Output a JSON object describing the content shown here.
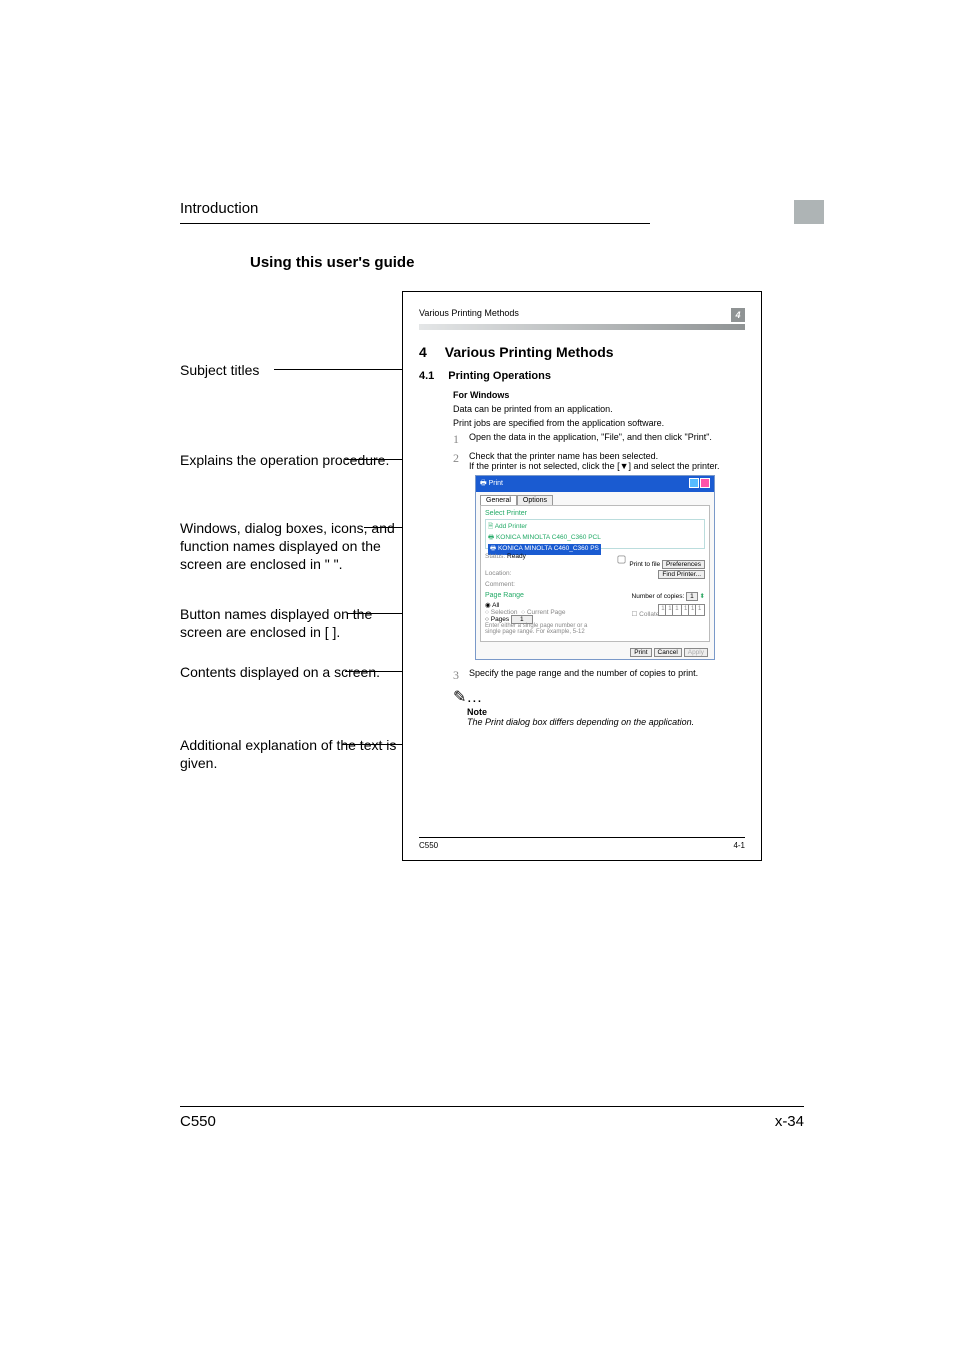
{
  "breadcrumb": "Introduction",
  "section_title": "Using this user's guide",
  "labels": {
    "l1": "Subject titles",
    "l2": "Explains the operation procedure.",
    "l3": "Windows, dialog boxes, icons, and function names displayed on the screen are enclosed in \" \".",
    "l4": "Button names displayed on the screen are enclosed in [  ].",
    "l5": "Contents displayed on a screen.",
    "l6": "Additional explanation of the text is given."
  },
  "sample": {
    "header_text": "Various Printing Methods",
    "header_num": "4",
    "h1_num": "4",
    "h1_text": "Various Printing Methods",
    "h2_num": "4.1",
    "h2_text": "Printing Operations",
    "h3": "For Windows",
    "body1": "Data can be printed from an application.",
    "body2": "Print jobs are specified from the application software.",
    "step1": "Open the data in the application, \"File\", and then click \"Print\".",
    "step2a": "Check that the printer name has been selected.",
    "step2b": "If the printer is not selected, click the [▼] and select the printer.",
    "step3": "Specify the page range and the number of copies to print.",
    "note_hd": "Note",
    "note_tx": "The Print dialog box differs depending on the application.",
    "footer_model": "C550",
    "footer_page": "4-1"
  },
  "dialog": {
    "title": "Print",
    "tab1": "General",
    "tab2": "Options",
    "select_printer": "Select Printer",
    "add_printer": "Add Printer",
    "p1": "KONICA MINOLTA C460_C360 PCL",
    "p2": "KONICA MINOLTA C460_C360 PS",
    "status_l": "Status:",
    "status_v": "Ready",
    "location": "Location:",
    "comment": "Comment:",
    "to_file": "Print to file",
    "preferences": "Preferences",
    "find_printer": "Find Printer...",
    "page_range": "Page Range",
    "all": "All",
    "selection": "Selection",
    "current": "Current Page",
    "pages": "Pages",
    "pages_hint": "Enter either a single page number or a single page range. For example, 5-12",
    "copies_l": "Number of copies:",
    "copies_v": "1",
    "collate": "Collate",
    "print": "Print",
    "cancel": "Cancel",
    "apply": "Apply"
  },
  "footer": {
    "model": "C550",
    "page": "x-34"
  }
}
